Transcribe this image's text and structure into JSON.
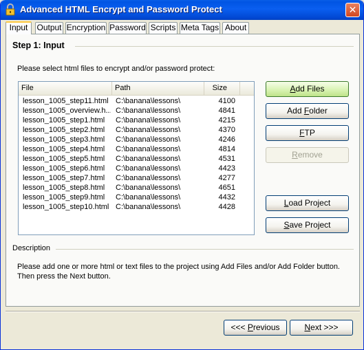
{
  "window": {
    "title": "Advanced HTML Encrypt and Password Protect"
  },
  "tabs": [
    {
      "label": "Input",
      "active": true
    },
    {
      "label": "Output"
    },
    {
      "label": "Encryption"
    },
    {
      "label": "Password"
    },
    {
      "label": "Scripts"
    },
    {
      "label": "Meta Tags"
    },
    {
      "label": "About"
    }
  ],
  "step": {
    "title": "Step 1: Input",
    "instruction": "Please select html files to encrypt and/or password protect:"
  },
  "files": {
    "columns": [
      "File",
      "Path",
      "Size"
    ],
    "rows": [
      {
        "file": "lesson_1005_step11.html",
        "path": "C:\\banana\\lessons\\",
        "size": "4100"
      },
      {
        "file": "lesson_1005_overview.h...",
        "path": "C:\\banana\\lessons\\",
        "size": "4841"
      },
      {
        "file": "lesson_1005_step1.html",
        "path": "C:\\banana\\lessons\\",
        "size": "4215"
      },
      {
        "file": "lesson_1005_step2.html",
        "path": "C:\\banana\\lessons\\",
        "size": "4370"
      },
      {
        "file": "lesson_1005_step3.html",
        "path": "C:\\banana\\lessons\\",
        "size": "4246"
      },
      {
        "file": "lesson_1005_step4.html",
        "path": "C:\\banana\\lessons\\",
        "size": "4814"
      },
      {
        "file": "lesson_1005_step5.html",
        "path": "C:\\banana\\lessons\\",
        "size": "4531"
      },
      {
        "file": "lesson_1005_step6.html",
        "path": "C:\\banana\\lessons\\",
        "size": "4423"
      },
      {
        "file": "lesson_1005_step7.html",
        "path": "C:\\banana\\lessons\\",
        "size": "4277"
      },
      {
        "file": "lesson_1005_step8.html",
        "path": "C:\\banana\\lessons\\",
        "size": "4651"
      },
      {
        "file": "lesson_1005_step9.html",
        "path": "C:\\banana\\lessons\\",
        "size": "4432"
      },
      {
        "file": "lesson_1005_step10.html",
        "path": "C:\\banana\\lessons\\",
        "size": "4428"
      }
    ]
  },
  "buttons": {
    "add_files": {
      "pre": "",
      "key": "A",
      "post": "dd Files"
    },
    "add_folder": {
      "pre": "Add ",
      "key": "F",
      "post": "older"
    },
    "ftp": {
      "pre": "",
      "key": "F",
      "post": "TP"
    },
    "remove": {
      "pre": "",
      "key": "R",
      "post": "emove"
    },
    "load_project": {
      "pre": "",
      "key": "L",
      "post": "oad Project"
    },
    "save_project": {
      "pre": "",
      "key": "S",
      "post": "ave Project"
    },
    "previous": {
      "pre": "<<< ",
      "key": "P",
      "post": "revious"
    },
    "next": {
      "pre": "",
      "key": "N",
      "post": "ext >>>"
    }
  },
  "description": {
    "label": "Description",
    "text": "Please add one or more html or text files to the project using Add Files and/or Add Folder button. Then press the Next button."
  }
}
